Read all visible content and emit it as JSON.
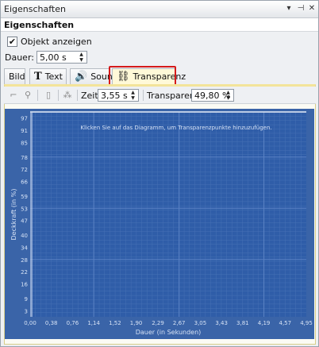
{
  "window": {
    "title": "Eigenschaften",
    "buttons": [
      "▾",
      "⊣",
      "✕"
    ]
  },
  "section": {
    "title": "Eigenschaften"
  },
  "show_object": {
    "label": "Objekt anzeigen",
    "checked": true
  },
  "duration": {
    "label": "Dauer:",
    "value": "5,00 s"
  },
  "tabs": [
    {
      "label": "Bild",
      "icon": ""
    },
    {
      "label": "Text",
      "icon": "text-icon"
    },
    {
      "label": "Sound",
      "icon": "speaker-icon"
    },
    {
      "label": "Transparenz",
      "icon": "transparency-icon",
      "active": true
    }
  ],
  "toolbar": {
    "time_label": "Zeit:",
    "time_value": "3,55 s",
    "transparency_label": "Transparenz:",
    "transparency_value": "49,80 %"
  },
  "chart_data": {
    "type": "line",
    "annotation": "Klicken Sie auf das Diagramm, um Transparenzpunkte hinzuzufügen.",
    "xlabel": "Dauer (in Sekunden)",
    "ylabel": "Deckkraft (in %)",
    "x_ticks": [
      "0,00",
      "0,38",
      "0,76",
      "1,14",
      "1,52",
      "1,90",
      "2,29",
      "2,67",
      "3,05",
      "3,43",
      "3,81",
      "4,19",
      "4,57",
      "4,95"
    ],
    "y_ticks": [
      "97",
      "91",
      "85",
      "78",
      "72",
      "66",
      "59",
      "53",
      "47",
      "40",
      "34",
      "28",
      "22",
      "16",
      "9",
      "3"
    ],
    "xlim": [
      0,
      4.95
    ],
    "ylim": [
      0,
      100
    ],
    "series": [
      {
        "x": [
          0,
          4.95
        ],
        "y": [
          100,
          100
        ]
      }
    ],
    "grid": true,
    "colors": {
      "background": "#2f5da8",
      "grid": "#5a82c4",
      "text": "#d6e2f5"
    }
  }
}
